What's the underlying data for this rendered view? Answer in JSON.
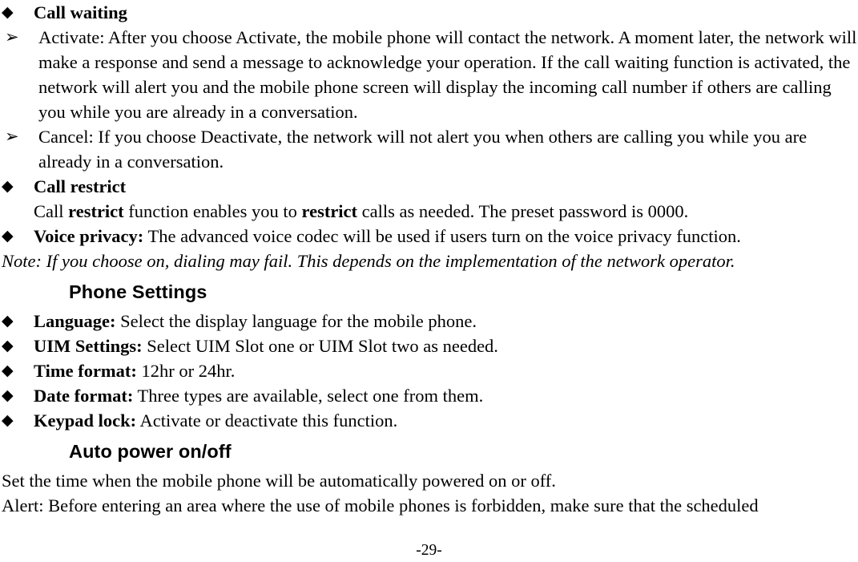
{
  "document": {
    "page_number_label": "-29-",
    "bullet_glyph_diamond": "◆",
    "bullet_glyph_arrow": "➢"
  },
  "sections": [
    {
      "id": "call-waiting",
      "heading": "Call waiting",
      "items": [
        {
          "id": "activate",
          "text": "Activate: After you choose Activate, the mobile phone will contact the network. A moment later, the network will make a response and send a message to acknowledge your operation. If the call waiting function is activated, the network will alert you and the mobile phone screen will display the incoming call number if others are calling you while you are already in a conversation."
        },
        {
          "id": "cancel",
          "text": "Cancel: If you choose Deactivate, the network will not alert you when others are calling you while you are already in a conversation."
        }
      ]
    },
    {
      "id": "call-restrict",
      "heading": "Call restrict",
      "body_parts": [
        {
          "text": "Call ",
          "style": "regular"
        },
        {
          "text": "restrict",
          "style": "bold"
        },
        {
          "text": " function enables you to ",
          "style": "regular"
        },
        {
          "text": "restrict",
          "style": "bold"
        },
        {
          "text": " calls as needed. The preset password is 0000.",
          "style": "regular"
        }
      ]
    },
    {
      "id": "voice-privacy",
      "label": "Voice privacy:",
      "body": " The advanced voice codec will be used if users turn on the voice privacy function."
    }
  ],
  "note": "Note: If you choose on, dialing may fail. This depends on the implementation of the network operator.",
  "phone_settings": {
    "heading": "Phone Settings",
    "items": [
      {
        "label": "Language:",
        "body": " Select the display language for the mobile phone."
      },
      {
        "label": "UIM Settings:",
        "body": " Select UIM Slot one or UIM Slot two as needed."
      },
      {
        "label": "Time format:",
        "body": " 12hr or 24hr."
      },
      {
        "label": "Date format:",
        "body": " Three types are available, select one from them."
      },
      {
        "label": "Keypad lock:",
        "body": " Activate or deactivate this function."
      }
    ]
  },
  "auto_power": {
    "heading": "Auto power on/off",
    "paragraphs": [
      "Set the time when the mobile phone will be automatically powered on or off.",
      "Alert: Before entering an area where the use of mobile phones is forbidden, make sure that the scheduled"
    ]
  }
}
